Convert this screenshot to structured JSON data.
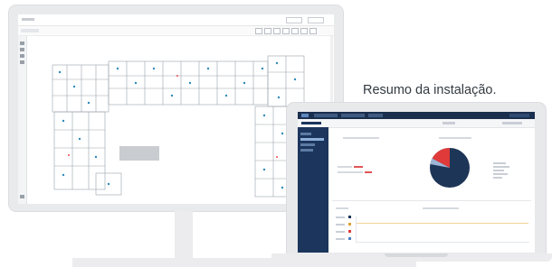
{
  "caption": "Resumo da instalação.",
  "colors": {
    "navy": "#1b355c",
    "pie_red": "#e03a3a",
    "accent_blue": "#3f5a80"
  },
  "icons": {
    "monitor_tools": [
      "toolbar-tool-icon"
    ],
    "laptop_nav": [
      "app-logo-icon"
    ]
  }
}
